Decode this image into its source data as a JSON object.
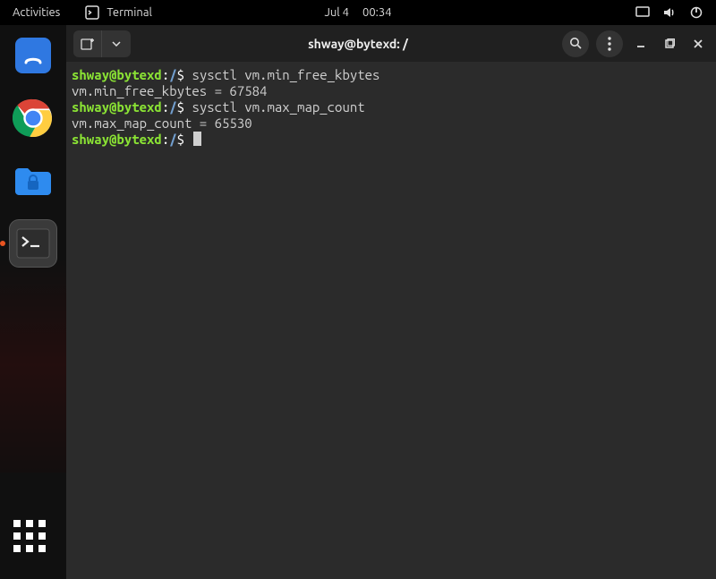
{
  "panel": {
    "activities": "Activities",
    "active_app": "Terminal",
    "clock_date": "Jul 4",
    "clock_time": "00:34"
  },
  "dock": {
    "items": [
      {
        "name": "software-store",
        "icon": "shopping-bag-icon"
      },
      {
        "name": "google-chrome",
        "icon": "chrome-icon"
      },
      {
        "name": "files",
        "icon": "files-icon"
      },
      {
        "name": "terminal",
        "icon": "terminal-icon",
        "active": true
      }
    ],
    "show_apps_label": "Show Applications"
  },
  "window": {
    "title": "shway@bytexd: /"
  },
  "terminal": {
    "prompt": {
      "user": "shway@bytexd",
      "sep": ":",
      "path": "/",
      "symbol": "$"
    },
    "lines": [
      {
        "type": "prompt",
        "cmd": "sysctl vm.min_free_kbytes"
      },
      {
        "type": "output",
        "text": "vm.min_free_kbytes = 67584"
      },
      {
        "type": "prompt",
        "cmd": "sysctl vm.max_map_count"
      },
      {
        "type": "output",
        "text": "vm.max_map_count = 65530"
      },
      {
        "type": "prompt",
        "cmd": "",
        "cursor": true
      }
    ]
  }
}
